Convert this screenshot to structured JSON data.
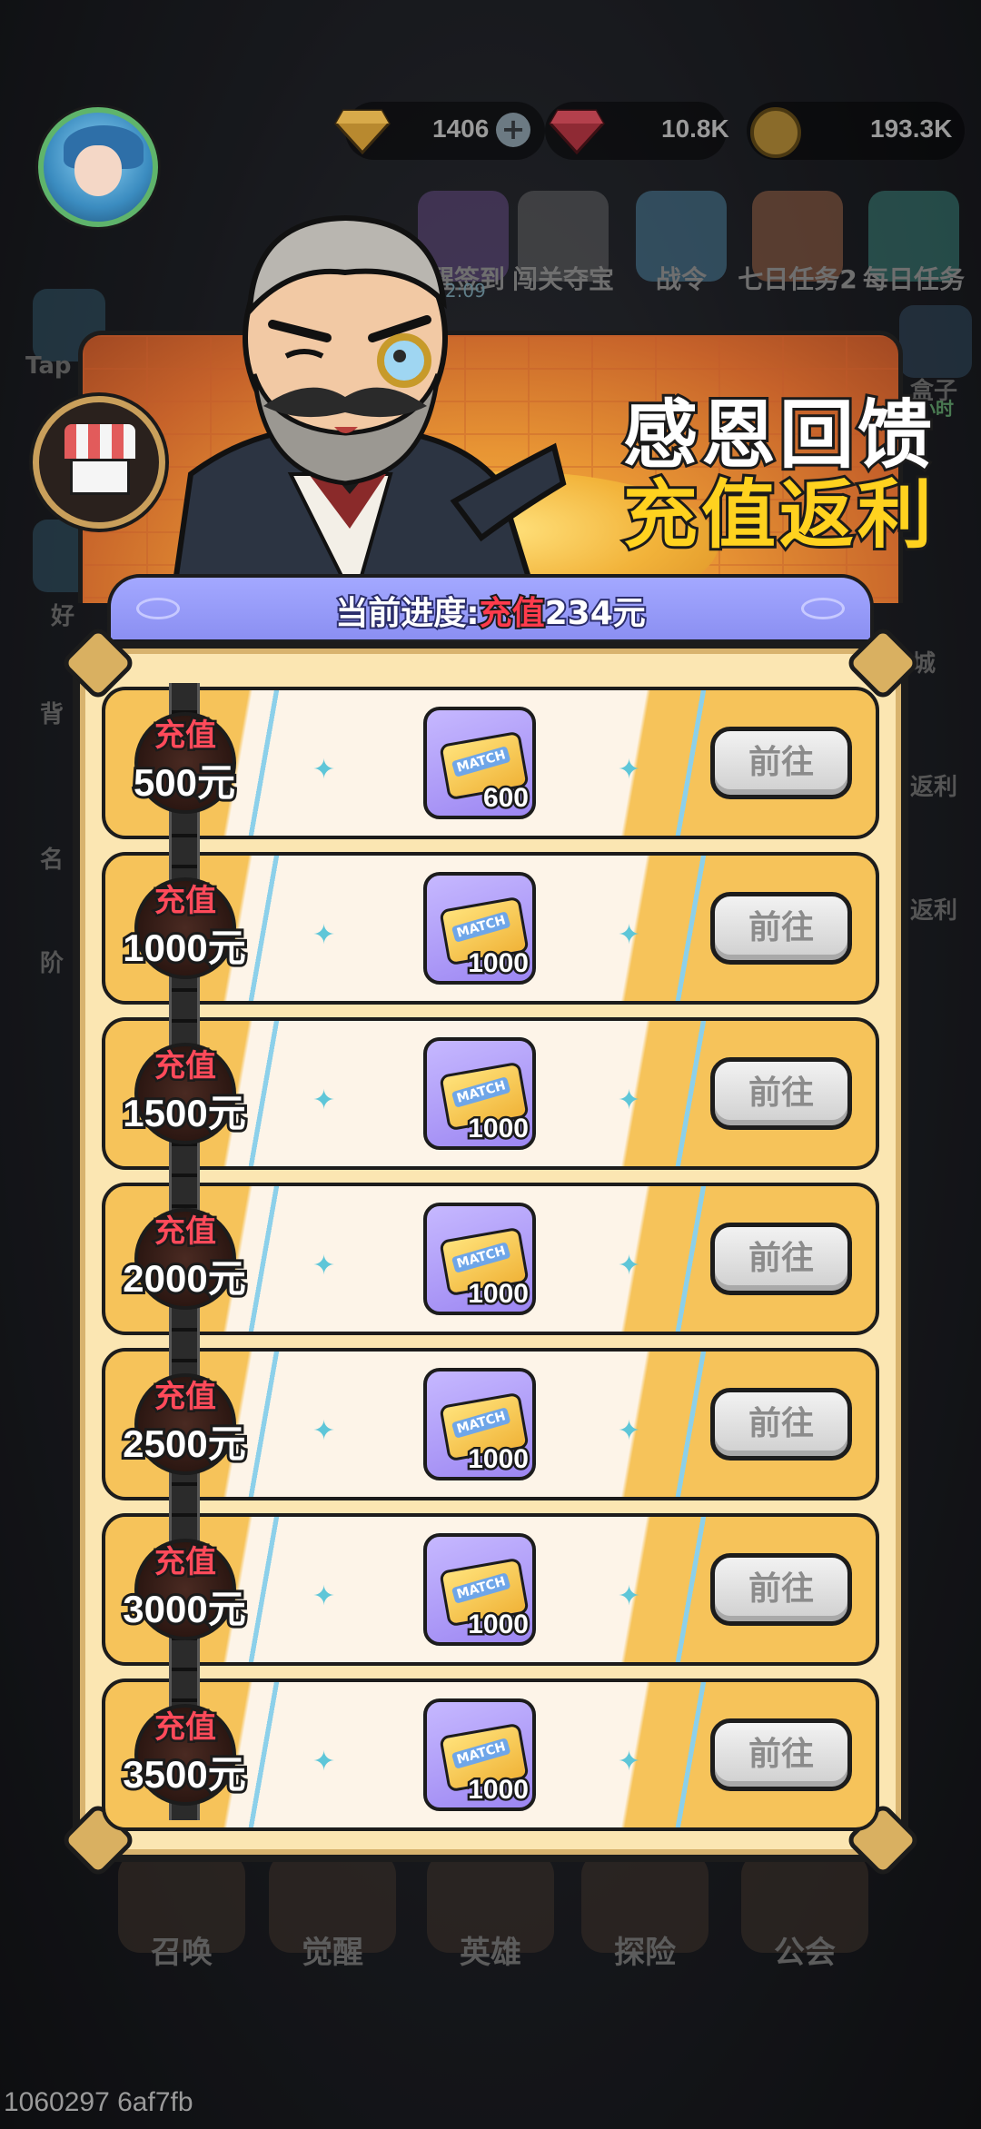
{
  "resources": {
    "gold_gem": "1406",
    "red_gem": "10.8K",
    "coin": "193.3K"
  },
  "top_events": [
    {
      "label": "觉醒签到",
      "timer": "08:52:09"
    },
    {
      "label": "闯关夺宝"
    },
    {
      "label": "战令"
    },
    {
      "label": "七日任务2"
    },
    {
      "label": "每日任务"
    }
  ],
  "side": {
    "left_labels": [
      "Tap",
      "好",
      "背",
      "名",
      "阶"
    ],
    "right_labels": [
      "盒子",
      "小时",
      "城",
      "返利",
      "返利"
    ]
  },
  "bottom_nav": [
    "召唤",
    "觉醒",
    "英雄",
    "探险",
    "公会"
  ],
  "popup": {
    "title_line1": "感恩回馈",
    "title_line2": "充值返利",
    "progress_prefix": "当前进度:",
    "progress_highlight": "充值",
    "progress_value": "234元",
    "tier_label": "充值",
    "ticket_text": "MATCH",
    "button_label": "前往",
    "tiers": [
      {
        "amount": "500元",
        "reward_qty": "600"
      },
      {
        "amount": "1000元",
        "reward_qty": "1000"
      },
      {
        "amount": "1500元",
        "reward_qty": "1000"
      },
      {
        "amount": "2000元",
        "reward_qty": "1000"
      },
      {
        "amount": "2500元",
        "reward_qty": "1000"
      },
      {
        "amount": "3000元",
        "reward_qty": "1000"
      },
      {
        "amount": "3500元",
        "reward_qty": "1000"
      }
    ]
  },
  "build_id": "1060297 6af7fb"
}
